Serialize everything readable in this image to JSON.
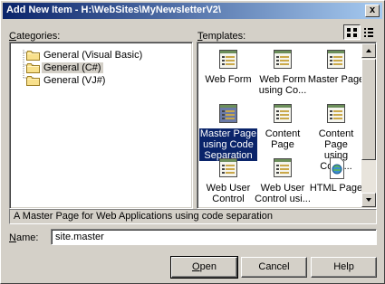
{
  "window": {
    "title": "Add New Item - H:\\WebSites\\MyNewsletterV2\\",
    "close_glyph": "x"
  },
  "categories": {
    "label_mnemonic": "C",
    "label_rest": "ategories:",
    "items": [
      {
        "label": "General (Visual Basic)",
        "icon": "folder-icon"
      },
      {
        "label": "General (C#)",
        "icon": "folder-icon",
        "selected": true
      },
      {
        "label": "General (VJ#)",
        "icon": "folder-icon"
      }
    ]
  },
  "templates": {
    "label_mnemonic": "T",
    "label_rest": "emplates:",
    "view_buttons": [
      "large-icons-view-icon",
      "small-icons-view-icon"
    ],
    "items": [
      {
        "line1": "Web Form",
        "line2": "",
        "line3": "",
        "icon": "web-form-icon"
      },
      {
        "line1": "Web Form",
        "line2": "using Co...",
        "line3": "",
        "icon": "web-form-icon"
      },
      {
        "line1": "Master Page",
        "line2": "",
        "line3": "",
        "icon": "master-page-icon"
      },
      {
        "line1": "Master Page",
        "line2": "using Code",
        "line3": "Separation",
        "icon": "master-page-icon",
        "selected": true
      },
      {
        "line1": "Content Page",
        "line2": "",
        "line3": "",
        "icon": "content-page-icon"
      },
      {
        "line1": "Content Page",
        "line2": "using Code...",
        "line3": "",
        "icon": "content-page-icon"
      },
      {
        "line1": "Web User",
        "line2": "Control",
        "line3": "",
        "icon": "web-user-control-icon"
      },
      {
        "line1": "Web User",
        "line2": "Control usi...",
        "line3": "",
        "icon": "web-user-control-icon"
      },
      {
        "line1": "HTML Page",
        "line2": "",
        "line3": "",
        "icon": "html-page-icon"
      }
    ]
  },
  "description": "A Master Page for Web Applications using code separation",
  "name_field": {
    "label_mnemonic": "N",
    "label_rest": "ame:",
    "value": "site.master"
  },
  "buttons": {
    "open": {
      "mnemonic": "O",
      "rest": "pen"
    },
    "cancel": "Cancel",
    "help": "Help"
  },
  "colors": {
    "face": "#d4d0c8",
    "title_start": "#0a246a",
    "title_end": "#a6caf0",
    "selection": "#0a246a"
  }
}
